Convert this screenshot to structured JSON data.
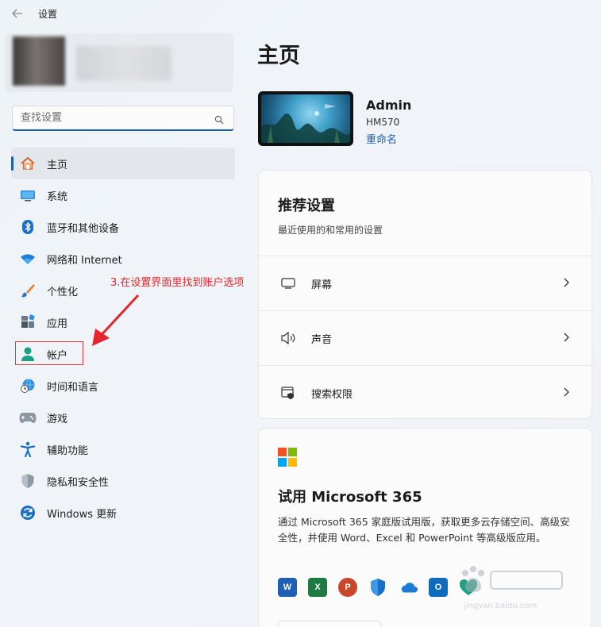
{
  "window": {
    "title": "设置"
  },
  "search": {
    "placeholder": "查找设置"
  },
  "sidebar": {
    "items": [
      {
        "label": "主页"
      },
      {
        "label": "系统"
      },
      {
        "label": "蓝牙和其他设备"
      },
      {
        "label": "网络和 Internet"
      },
      {
        "label": "个性化"
      },
      {
        "label": "应用"
      },
      {
        "label": "帐户"
      },
      {
        "label": "时间和语言"
      },
      {
        "label": "游戏"
      },
      {
        "label": "辅助功能"
      },
      {
        "label": "隐私和安全性"
      },
      {
        "label": "Windows 更新"
      }
    ],
    "active_index": 0
  },
  "annotation": {
    "text": "3.在设置界面里找到账户选项",
    "color": "#e3262d"
  },
  "main": {
    "title": "主页",
    "device": {
      "name": "Admin",
      "model": "HM570",
      "rename_label": "重命名"
    },
    "recommended": {
      "title": "推荐设置",
      "subtitle": "最近使用的和常用的设置",
      "rows": [
        {
          "label": "屏幕",
          "icon": "monitor-icon"
        },
        {
          "label": "声音",
          "icon": "speaker-icon"
        },
        {
          "label": "搜索权限",
          "icon": "search-permissions-icon"
        }
      ]
    },
    "microsoft365": {
      "title": "试用 Microsoft 365",
      "description": "通过 Microsoft 365 家庭版试用版，获取更多云存储空间、高级安全性，并使用 Word、Excel 和 PowerPoint 等高级版应用。",
      "apps": [
        {
          "name": "word-icon",
          "letter": "W",
          "color": "#1f5fb4"
        },
        {
          "name": "excel-icon",
          "letter": "X",
          "color": "#1d7a43"
        },
        {
          "name": "powerpoint-icon",
          "letter": "P",
          "color": "#c8462a"
        },
        {
          "name": "defender-icon",
          "letter": "",
          "color": "#1a6fc4"
        },
        {
          "name": "onedrive-icon",
          "letter": "",
          "color": "#1b7bd6"
        },
        {
          "name": "outlook-icon",
          "letter": "O",
          "color": "#0f6cbd"
        },
        {
          "name": "family-safety-icon",
          "letter": "",
          "color": "#1aa083"
        }
      ]
    }
  },
  "watermark": {
    "text": "jingyan.baidu.com"
  },
  "colors": {
    "accent": "#1f5fb0",
    "link": "#1a5fb4",
    "annotation_red": "#e3262d"
  }
}
